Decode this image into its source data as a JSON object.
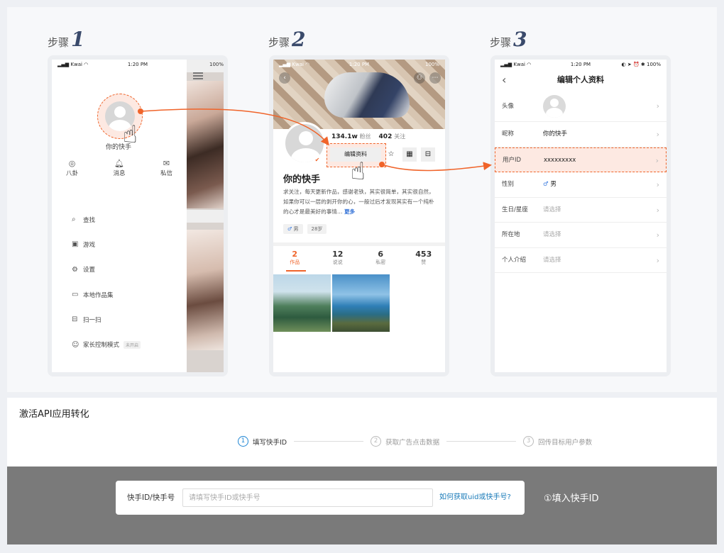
{
  "steps": [
    {
      "label": "步骤",
      "num": "1"
    },
    {
      "label": "步骤",
      "num": "2"
    },
    {
      "label": "步骤",
      "num": "3"
    }
  ],
  "phone1": {
    "status": {
      "carrier": "Kwai",
      "time": "1:20 PM",
      "battery": "100%"
    },
    "nickname": "你的快手",
    "quick_icons": [
      {
        "icon": "eye-icon",
        "glyph": "◎",
        "label": "八卦"
      },
      {
        "icon": "bell-icon",
        "glyph": "♫",
        "label": "消息"
      },
      {
        "icon": "mail-icon",
        "glyph": "✉",
        "label": "私信"
      }
    ],
    "menu": [
      {
        "icon": "search-icon",
        "glyph": "⌕",
        "label": "查找"
      },
      {
        "icon": "gamepad-icon",
        "glyph": "▣",
        "label": "游戏"
      },
      {
        "icon": "settings-icon",
        "glyph": "⚙",
        "label": "设置"
      },
      {
        "icon": "folder-icon",
        "glyph": "▭",
        "label": "本地作品集"
      },
      {
        "icon": "scan-icon",
        "glyph": "⊟",
        "label": "扫一扫"
      },
      {
        "icon": "parental-icon",
        "glyph": "☺",
        "label": "家长控制模式",
        "tag": "未开启"
      }
    ]
  },
  "phone2": {
    "status": {
      "carrier": "Kwai",
      "time": "1:20 PM",
      "battery": "100%"
    },
    "fans": "134.1w",
    "fans_unit": "粉丝",
    "following": "402",
    "following_unit": "关注",
    "edit_label": "编辑资料",
    "name": "你的快手",
    "bio": "求关注，每天更新作品，感谢老铁，其实很简单，其实很自然，如果你可以一层的剥开你的心，一般过后才发现其实有一个纯朴的心才是最美好的事情…",
    "more": "更多",
    "gender_chip": "男",
    "age_chip": "28岁",
    "tabs": [
      {
        "n": "2",
        "t": "作品"
      },
      {
        "n": "12",
        "t": "说说"
      },
      {
        "n": "6",
        "t": "私密"
      },
      {
        "n": "453",
        "t": "赞"
      }
    ]
  },
  "phone3": {
    "status": {
      "carrier": "Kwai",
      "time": "1:20 PM",
      "battery": "100%"
    },
    "title": "编辑个人资料",
    "rows": {
      "avatar": "头像",
      "nickname_label": "昵称",
      "nickname_value": "你的快手",
      "uid_label": "用户ID",
      "uid_value": "xxxxxxxxx",
      "gender_label": "性别",
      "gender_value": "男",
      "birthday_label": "生日/星座",
      "birthday_value": "请选择",
      "location_label": "所在地",
      "location_value": "请选择",
      "intro_label": "个人介绍",
      "intro_value": "请选择"
    }
  },
  "section": {
    "title": "激活API应用转化",
    "stepper": [
      {
        "n": "1",
        "label": "填写快手ID"
      },
      {
        "n": "2",
        "label": "获取广告点击数据"
      },
      {
        "n": "3",
        "label": "回传目标用户参数"
      }
    ]
  },
  "form": {
    "label": "快手ID/快手号",
    "value": "",
    "placeholder": "请填写快手ID或快手号",
    "help_link": "如何获取uid或快手号?",
    "callout": "①填入快手ID"
  },
  "colors": {
    "accent": "#f0642a",
    "link": "#1a7bb9",
    "active_step": "#1f86d4"
  }
}
